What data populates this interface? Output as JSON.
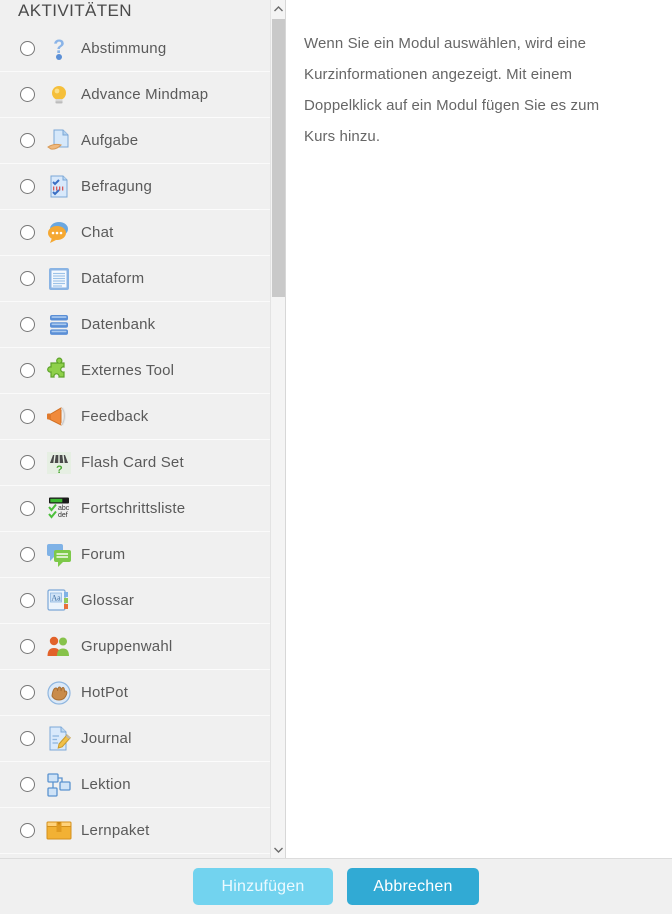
{
  "panel": {
    "title": "AKTIVITÄTEN"
  },
  "info": {
    "description": "Wenn Sie ein Modul auswählen, wird eine Kurzinformationen angezeigt. Mit einem Doppelklick auf ein Modul fügen Sie es zum Kurs hinzu."
  },
  "scrollbar": {
    "up_arrow": "chevron-up-icon",
    "down_arrow": "chevron-down-icon"
  },
  "colors": {
    "panel_background": "#f0f0f0",
    "info_background": "#ffffff",
    "add_button": "#72d3ef",
    "cancel_button": "#31aad4",
    "label_text": "#5a5a5a",
    "info_text": "#666666",
    "scroll_thumb": "#c9c9c9"
  },
  "activities": [
    {
      "label": "Abstimmung",
      "icon": "question-mark-icon"
    },
    {
      "label": "Advance Mindmap",
      "icon": "lightbulb-icon"
    },
    {
      "label": "Aufgabe",
      "icon": "document-hand-icon"
    },
    {
      "label": "Befragung",
      "icon": "survey-checklist-icon"
    },
    {
      "label": "Chat",
      "icon": "chat-bubbles-icon"
    },
    {
      "label": "Dataform",
      "icon": "lined-document-icon"
    },
    {
      "label": "Datenbank",
      "icon": "database-stack-icon"
    },
    {
      "label": "Externes Tool",
      "icon": "puzzle-piece-icon"
    },
    {
      "label": "Feedback",
      "icon": "megaphone-icon"
    },
    {
      "label": "Flash Card Set",
      "icon": "flash-cards-icon"
    },
    {
      "label": "Fortschrittsliste",
      "icon": "progress-checklist-icon"
    },
    {
      "label": "Forum",
      "icon": "forum-bubbles-icon"
    },
    {
      "label": "Glossar",
      "icon": "glossary-book-icon"
    },
    {
      "label": "Gruppenwahl",
      "icon": "group-people-icon"
    },
    {
      "label": "HotPot",
      "icon": "hotpot-hand-icon"
    },
    {
      "label": "Journal",
      "icon": "document-pencil-icon"
    },
    {
      "label": "Lektion",
      "icon": "lesson-tree-icon"
    },
    {
      "label": "Lernpaket",
      "icon": "package-box-icon"
    }
  ],
  "footer": {
    "add_label": "Hinzufügen",
    "cancel_label": "Abbrechen"
  }
}
